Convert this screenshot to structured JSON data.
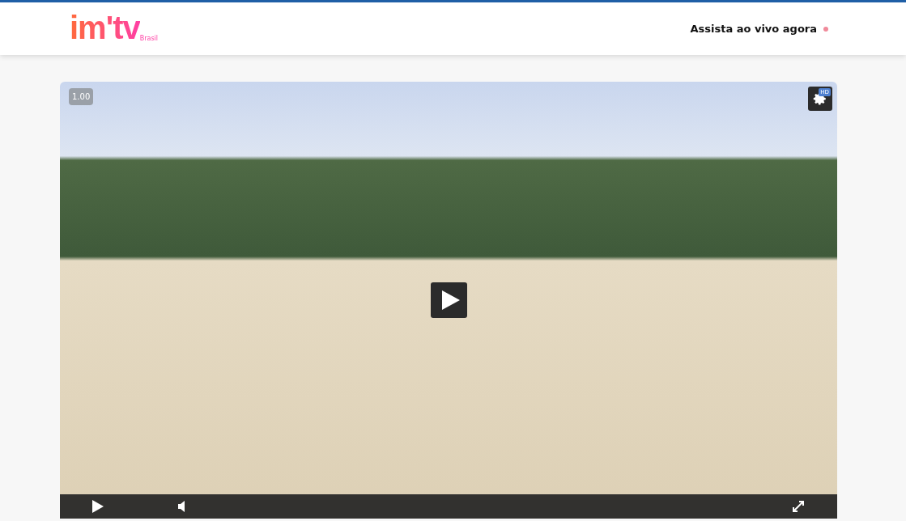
{
  "header": {
    "logo": {
      "name": "im'tv",
      "suffix": "Brasil"
    },
    "live_link": {
      "label": "Assista ao vivo agora"
    }
  },
  "player": {
    "speed": "1.00",
    "quality_badge": "HD",
    "playing": false
  }
}
